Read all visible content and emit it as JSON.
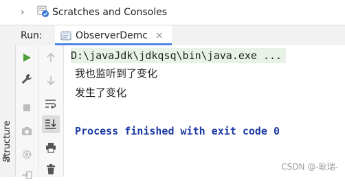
{
  "project_tree": {
    "item_label": "Scratches and Consoles",
    "icons": {
      "chevron": "chevron-right-icon",
      "scratches": "scratches-icon"
    }
  },
  "run_panel": {
    "title": "Run:",
    "active_tab": {
      "label": "ObserverDemc",
      "close": "×",
      "icon": "run-config-icon"
    }
  },
  "left_strip": {
    "label": "Structure"
  },
  "toolbar": {
    "col1": [
      "run-icon",
      "wrench-icon",
      "stop-icon",
      "camera-icon",
      "settings-gear-icon",
      "login-icon"
    ],
    "col2": [
      "arrow-up-icon",
      "arrow-down-icon",
      "soft-wrap-icon",
      "scroll-to-end-icon",
      "print-icon",
      "trash-icon"
    ]
  },
  "console": {
    "command": "D:\\javaJdk\\jdkqsq\\bin\\java.exe ...",
    "output_lines": [
      "我也监听到了变化",
      "发生了变化"
    ],
    "exit_message": "Process finished with exit code 0"
  },
  "watermark": "CSDN @-耿瑞-",
  "colors": {
    "accent_blue": "#4a86e8",
    "exit_text": "#1c3aa3",
    "run_green": "#4c9f3b",
    "cmd_highlight": "#e8f2e6"
  }
}
